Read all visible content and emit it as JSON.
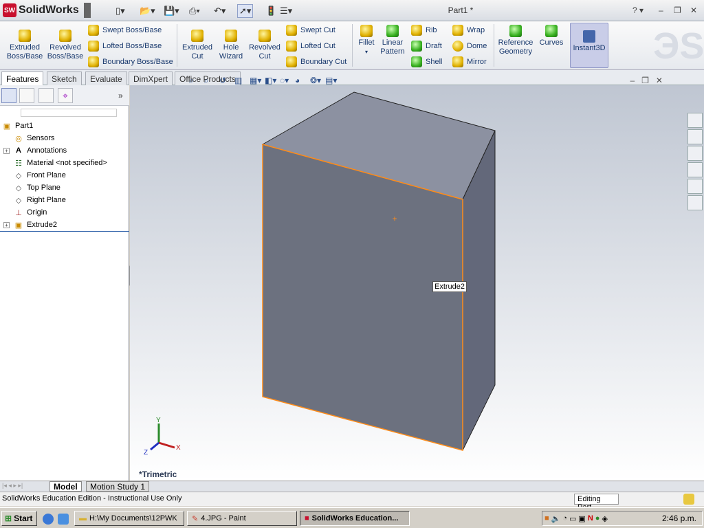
{
  "app": {
    "name": "SolidWorks",
    "doc_title": "Part1 *"
  },
  "ribbon": {
    "extruded_boss": "Extruded\nBoss/Base",
    "revolved_boss": "Revolved\nBoss/Base",
    "swept_boss": "Swept Boss/Base",
    "lofted_boss": "Lofted Boss/Base",
    "boundary_boss": "Boundary Boss/Base",
    "extruded_cut": "Extruded\nCut",
    "hole_wizard": "Hole\nWizard",
    "revolved_cut": "Revolved\nCut",
    "swept_cut": "Swept Cut",
    "lofted_cut": "Lofted Cut",
    "boundary_cut": "Boundary Cut",
    "fillet": "Fillet",
    "linear_pattern": "Linear\nPattern",
    "rib": "Rib",
    "draft": "Draft",
    "shell": "Shell",
    "wrap": "Wrap",
    "dome": "Dome",
    "mirror": "Mirror",
    "reference_geometry": "Reference\nGeometry",
    "curves": "Curves",
    "instant3d": "Instant3D"
  },
  "tabs": [
    "Features",
    "Sketch",
    "Evaluate",
    "DimXpert",
    "Office Products"
  ],
  "tree": {
    "root": "Part1",
    "items": [
      "Sensors",
      "Annotations",
      "Material <not specified>",
      "Front Plane",
      "Top Plane",
      "Right Plane",
      "Origin",
      "Extrude2"
    ]
  },
  "viewport": {
    "view_label": "*Trimetric",
    "tooltip": "Extrude2",
    "axis_x": "X",
    "axis_y": "Y",
    "axis_z": "Z"
  },
  "bottom_tabs": [
    "Model",
    "Motion Study 1"
  ],
  "status": {
    "text": "SolidWorks Education Edition - Instructional Use Only",
    "mode": "Editing Part"
  },
  "taskbar": {
    "start": "Start",
    "tasks": [
      "H:\\My Documents\\12PWK",
      "4.JPG - Paint",
      "SolidWorks Education..."
    ],
    "clock": "2:46 p.m."
  },
  "colors": {
    "edge": "#ff8c1a",
    "face_front": "#6c717f",
    "face_top": "#8c91a1",
    "face_side": "#63687a"
  }
}
